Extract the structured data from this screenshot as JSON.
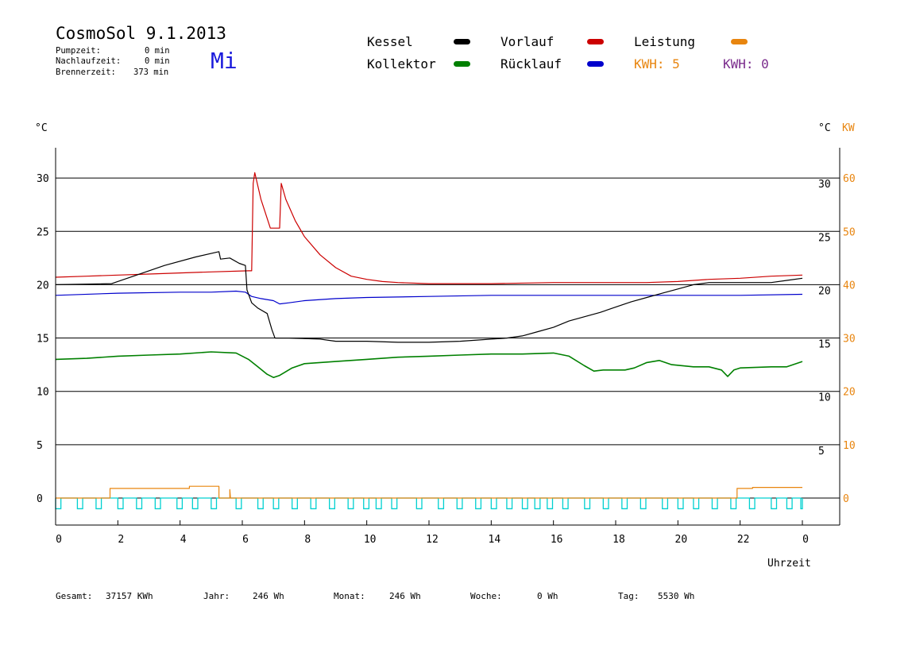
{
  "header": {
    "title": "CosmoSol 9.1.2013",
    "pump_label": "Pumpzeit:",
    "pump_value": "0 min",
    "nachlauf_label": "Nachlaufzeit:",
    "nachlauf_value": "0 min",
    "brenner_label": "Brennerzeit:",
    "brenner_value": "373 min",
    "day": "Mi"
  },
  "legend": {
    "kessel": "Kessel",
    "kollektor": "Kollektor",
    "vorlauf": "Vorlauf",
    "ruecklauf": "Rücklauf",
    "leistung": "Leistung",
    "kwh1_label": "KWH: 5",
    "kwh2_label": "KWH: 0"
  },
  "axes": {
    "left_unit": "°C",
    "right_unit_c": "°C",
    "right_unit_kw": "KW",
    "x_label": "Uhrzeit"
  },
  "footer": {
    "gesamt_label": "Gesamt:",
    "gesamt_value": "37157 KWh",
    "jahr_label": "Jahr:",
    "jahr_value": "246 Wh",
    "monat_label": "Monat:",
    "monat_value": "246 Wh",
    "woche_label": "Woche:",
    "woche_value": "0 Wh",
    "tag_label": "Tag:",
    "tag_value": "5530 Wh"
  },
  "colors": {
    "kessel": "#000000",
    "kollektor": "#008000",
    "vorlauf": "#cc0000",
    "ruecklauf": "#0000cc",
    "leistung": "#e8850f",
    "kwh2": "#7a2b8c",
    "pump": "#00d0d0",
    "grid": "#000000"
  },
  "chart_data": {
    "type": "line",
    "title": "CosmoSol 9.1.2013",
    "xlabel": "Uhrzeit",
    "ylabel": "°C",
    "xlim": [
      0,
      24
    ],
    "ylim": [
      -2.5,
      32
    ],
    "x_ticks": [
      0,
      2,
      4,
      6,
      8,
      10,
      12,
      14,
      16,
      18,
      20,
      22,
      24
    ],
    "x_tick_labels": [
      "0",
      "2",
      "4",
      "6",
      "8",
      "10",
      "12",
      "14",
      "16",
      "18",
      "20",
      "22",
      "0"
    ],
    "y_ticks": [
      0,
      5,
      10,
      15,
      20,
      25,
      30
    ],
    "y_right_c_ticks": [
      5,
      10,
      15,
      20,
      25,
      30
    ],
    "y_right_kw_ticks": [
      0,
      10,
      20,
      30,
      40,
      50,
      60
    ],
    "grid": true,
    "series": [
      {
        "name": "Vorlauf",
        "points": [
          [
            0,
            20.7
          ],
          [
            1,
            20.8
          ],
          [
            2,
            20.9
          ],
          [
            3,
            21.0
          ],
          [
            4,
            21.1
          ],
          [
            5,
            21.2
          ],
          [
            6.2,
            21.3
          ],
          [
            6.3,
            21.3
          ],
          [
            6.35,
            29.5
          ],
          [
            6.4,
            30.5
          ],
          [
            6.6,
            28.0
          ],
          [
            6.9,
            25.3
          ],
          [
            7.2,
            25.3
          ],
          [
            7.25,
            29.5
          ],
          [
            7.4,
            28.0
          ],
          [
            7.7,
            26.0
          ],
          [
            8.0,
            24.5
          ],
          [
            8.5,
            22.8
          ],
          [
            9.0,
            21.6
          ],
          [
            9.5,
            20.8
          ],
          [
            10.0,
            20.5
          ],
          [
            10.5,
            20.3
          ],
          [
            11,
            20.2
          ],
          [
            12,
            20.1
          ],
          [
            14,
            20.1
          ],
          [
            16,
            20.2
          ],
          [
            18,
            20.2
          ],
          [
            19,
            20.2
          ],
          [
            20,
            20.3
          ],
          [
            21,
            20.5
          ],
          [
            22,
            20.6
          ],
          [
            23,
            20.8
          ],
          [
            24,
            20.9
          ]
        ]
      },
      {
        "name": "Rücklauf",
        "points": [
          [
            0,
            19.0
          ],
          [
            2,
            19.2
          ],
          [
            4,
            19.3
          ],
          [
            5,
            19.3
          ],
          [
            5.8,
            19.4
          ],
          [
            6.1,
            19.3
          ],
          [
            6.3,
            18.9
          ],
          [
            6.6,
            18.7
          ],
          [
            7.0,
            18.5
          ],
          [
            7.2,
            18.2
          ],
          [
            7.5,
            18.3
          ],
          [
            8,
            18.5
          ],
          [
            9,
            18.7
          ],
          [
            10,
            18.8
          ],
          [
            12,
            18.9
          ],
          [
            14,
            19.0
          ],
          [
            16,
            19.0
          ],
          [
            18,
            19.0
          ],
          [
            20,
            19.0
          ],
          [
            22,
            19.0
          ],
          [
            24,
            19.1
          ]
        ]
      },
      {
        "name": "Kessel",
        "points": [
          [
            0,
            20.0
          ],
          [
            1.8,
            20.1
          ],
          [
            2.5,
            20.8
          ],
          [
            3.5,
            21.8
          ],
          [
            4.5,
            22.6
          ],
          [
            5.25,
            23.1
          ],
          [
            5.3,
            22.4
          ],
          [
            5.6,
            22.5
          ],
          [
            5.9,
            22.0
          ],
          [
            6.1,
            21.8
          ],
          [
            6.15,
            19.5
          ],
          [
            6.3,
            18.3
          ],
          [
            6.5,
            17.8
          ],
          [
            6.8,
            17.3
          ],
          [
            6.95,
            15.8
          ],
          [
            7.05,
            15.0
          ],
          [
            7.5,
            15.0
          ],
          [
            8.5,
            14.9
          ],
          [
            9,
            14.7
          ],
          [
            10,
            14.7
          ],
          [
            11,
            14.6
          ],
          [
            12,
            14.6
          ],
          [
            13,
            14.7
          ],
          [
            14,
            14.9
          ],
          [
            14.5,
            15.0
          ],
          [
            15,
            15.2
          ],
          [
            15.5,
            15.6
          ],
          [
            16,
            16.0
          ],
          [
            16.5,
            16.6
          ],
          [
            17,
            17.0
          ],
          [
            17.5,
            17.4
          ],
          [
            18,
            17.9
          ],
          [
            18.5,
            18.4
          ],
          [
            19,
            18.8
          ],
          [
            19.5,
            19.2
          ],
          [
            20,
            19.6
          ],
          [
            20.5,
            20.0
          ],
          [
            21,
            20.2
          ],
          [
            22,
            20.2
          ],
          [
            23,
            20.2
          ],
          [
            23.5,
            20.4
          ],
          [
            24,
            20.6
          ]
        ]
      },
      {
        "name": "Kollektor",
        "points": [
          [
            0,
            13.0
          ],
          [
            1,
            13.1
          ],
          [
            2,
            13.3
          ],
          [
            3,
            13.4
          ],
          [
            4,
            13.5
          ],
          [
            5,
            13.7
          ],
          [
            5.8,
            13.6
          ],
          [
            6.2,
            13.0
          ],
          [
            6.5,
            12.3
          ],
          [
            6.8,
            11.6
          ],
          [
            7.0,
            11.3
          ],
          [
            7.2,
            11.5
          ],
          [
            7.6,
            12.2
          ],
          [
            8,
            12.6
          ],
          [
            9,
            12.8
          ],
          [
            10,
            13.0
          ],
          [
            11,
            13.2
          ],
          [
            12,
            13.3
          ],
          [
            13,
            13.4
          ],
          [
            14,
            13.5
          ],
          [
            15,
            13.5
          ],
          [
            16,
            13.6
          ],
          [
            16.5,
            13.3
          ],
          [
            17,
            12.4
          ],
          [
            17.3,
            11.9
          ],
          [
            17.6,
            12.0
          ],
          [
            18.3,
            12.0
          ],
          [
            18.6,
            12.2
          ],
          [
            19,
            12.7
          ],
          [
            19.4,
            12.9
          ],
          [
            19.8,
            12.5
          ],
          [
            20.5,
            12.3
          ],
          [
            21,
            12.3
          ],
          [
            21.4,
            12.0
          ],
          [
            21.6,
            11.4
          ],
          [
            21.8,
            12.0
          ],
          [
            22,
            12.2
          ],
          [
            23,
            12.3
          ],
          [
            23.5,
            12.3
          ],
          [
            24,
            12.8
          ]
        ]
      },
      {
        "name": "Leistung",
        "axis": "kw",
        "points": [
          [
            0,
            0
          ],
          [
            1.75,
            0
          ],
          [
            1.75,
            1.8
          ],
          [
            4.3,
            1.8
          ],
          [
            4.3,
            2.2
          ],
          [
            5.25,
            2.2
          ],
          [
            5.25,
            0
          ],
          [
            5.6,
            0
          ],
          [
            5.6,
            1.6
          ],
          [
            5.62,
            0
          ],
          [
            21.9,
            0
          ],
          [
            21.9,
            1.8
          ],
          [
            22.4,
            1.8
          ],
          [
            22.4,
            2.0
          ],
          [
            24,
            2.0
          ]
        ]
      }
    ],
    "pump_pulses": {
      "name": "Pumpe",
      "level": -1.0,
      "starts": [
        0.0,
        0.7,
        1.3,
        2.0,
        2.6,
        3.2,
        3.9,
        4.4,
        5.0,
        5.8,
        6.5,
        7.0,
        7.6,
        8.2,
        8.8,
        9.4,
        9.9,
        10.3,
        10.8,
        11.6,
        12.3,
        12.9,
        13.5,
        14.0,
        14.5,
        15.0,
        15.4,
        15.8,
        16.3,
        17.0,
        17.6,
        18.2,
        18.8,
        19.5,
        20.0,
        20.5,
        21.1,
        21.7,
        22.3,
        23.0,
        23.5,
        23.95
      ],
      "width": 0.17
    }
  }
}
